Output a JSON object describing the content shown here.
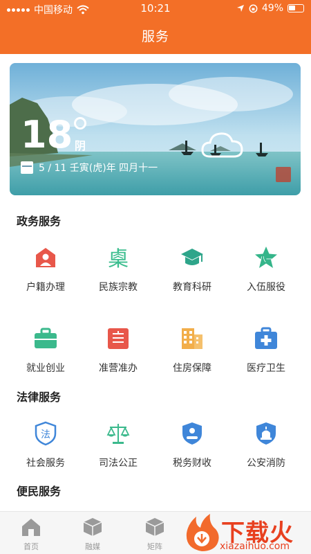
{
  "status_bar": {
    "carrier": "中国移动",
    "time": "10:21",
    "battery": "49%"
  },
  "header": {
    "title": "服务"
  },
  "weather": {
    "temperature": "18",
    "condition": "阴",
    "date": "5 / 11  壬寅(虎)年 四月十一"
  },
  "sections": [
    {
      "title": "政务服务",
      "items": [
        {
          "label": "户籍办理",
          "icon": "person-house-icon",
          "color": "#e8574a"
        },
        {
          "label": "民族宗教",
          "icon": "ethnic-glyph-icon",
          "color": "#3bbd8e"
        },
        {
          "label": "教育科研",
          "icon": "graduation-cap-icon",
          "color": "#2ea58a"
        },
        {
          "label": "入伍服役",
          "icon": "army-star-icon",
          "color": "#35b58a"
        },
        {
          "label": "就业创业",
          "icon": "briefcase-icon",
          "color": "#3bb98c"
        },
        {
          "label": "准营准办",
          "icon": "license-icon",
          "color": "#e8574a"
        },
        {
          "label": "住房保障",
          "icon": "building-icon",
          "color": "#f2ae4a"
        },
        {
          "label": "医疗卫生",
          "icon": "medical-kit-icon",
          "color": "#3f86d9"
        }
      ]
    },
    {
      "title": "法律服务",
      "items": [
        {
          "label": "社会服务",
          "icon": "law-shield-icon",
          "color": "#3f86d9"
        },
        {
          "label": "司法公正",
          "icon": "scales-icon",
          "color": "#3bb98c"
        },
        {
          "label": "税务财收",
          "icon": "tax-shield-icon",
          "color": "#3f86d9"
        },
        {
          "label": "公安消防",
          "icon": "police-shield-icon",
          "color": "#3f86d9"
        }
      ]
    },
    {
      "title": "便民服务",
      "items": []
    }
  ],
  "bottom_nav": [
    {
      "label": "首页",
      "icon": "home-icon"
    },
    {
      "label": "融媒",
      "icon": "cube-icon"
    },
    {
      "label": "矩阵",
      "icon": "matrix-cube-icon"
    }
  ],
  "watermark": {
    "title": "下载火",
    "url": "xiazaihuo.com"
  },
  "colors": {
    "header": "#f36f27",
    "watermark": "#e8401f"
  }
}
